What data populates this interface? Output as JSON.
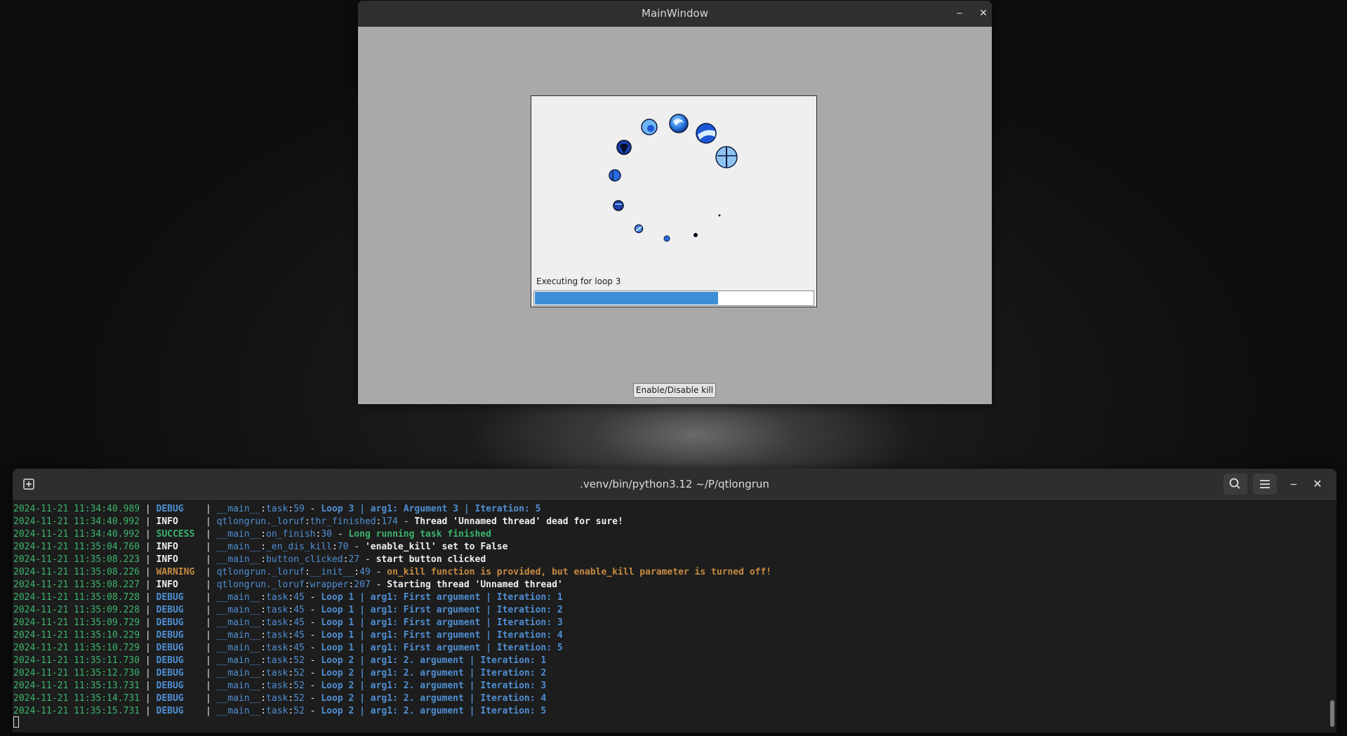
{
  "main_window": {
    "title": "MainWindow",
    "minimize_glyph": "‒",
    "close_glyph": "✕",
    "dialog": {
      "status_text": "Executing for loop 3",
      "progress_percent": 66
    },
    "kill_button_label": "Enable/Disable kill"
  },
  "terminal": {
    "title": ".venv/bin/python3.12 ~/P/qtlongrun",
    "new_tab_icon": "new-tab-icon",
    "search_icon": "search-icon",
    "menu_icon": "hamburger-menu-icon",
    "minimize_glyph": "‒",
    "close_glyph": "✕",
    "log_lines": [
      {
        "ts": "2024-11-21 11:34:40.989",
        "level": "DEBUG",
        "module": "__main__",
        "func": "task",
        "line": "59",
        "message": "Loop 3 | arg1: Argument 3 | Iteration: 5"
      },
      {
        "ts": "2024-11-21 11:34:40.992",
        "level": "INFO",
        "module": "qtlongrun._loruf",
        "func": "thr_finished",
        "line": "174",
        "message": "Thread 'Unnamed thread' dead for sure!"
      },
      {
        "ts": "2024-11-21 11:34:40.992",
        "level": "SUCCESS",
        "module": "__main__",
        "func": "on_finish",
        "line": "30",
        "message": "Long running task finished"
      },
      {
        "ts": "2024-11-21 11:35:04.760",
        "level": "INFO",
        "module": "__main__",
        "func": "_en_dis_kill",
        "line": "70",
        "message": "'enable_kill' set to False"
      },
      {
        "ts": "2024-11-21 11:35:08.223",
        "level": "INFO",
        "module": "__main__",
        "func": "button_clicked",
        "line": "27",
        "message": "start button clicked"
      },
      {
        "ts": "2024-11-21 11:35:08.226",
        "level": "WARNING",
        "module": "qtlongrun._loruf",
        "func": "__init__",
        "line": "49",
        "message": "on_kill function is provided, but enable_kill parameter is turned off!"
      },
      {
        "ts": "2024-11-21 11:35:08.227",
        "level": "INFO",
        "module": "qtlongrun._loruf",
        "func": "wrapper",
        "line": "207",
        "message": "Starting thread 'Unnamed thread'"
      },
      {
        "ts": "2024-11-21 11:35:08.728",
        "level": "DEBUG",
        "module": "__main__",
        "func": "task",
        "line": "45",
        "message": "Loop 1 | arg1: First argument | Iteration: 1"
      },
      {
        "ts": "2024-11-21 11:35:09.228",
        "level": "DEBUG",
        "module": "__main__",
        "func": "task",
        "line": "45",
        "message": "Loop 1 | arg1: First argument | Iteration: 2"
      },
      {
        "ts": "2024-11-21 11:35:09.729",
        "level": "DEBUG",
        "module": "__main__",
        "func": "task",
        "line": "45",
        "message": "Loop 1 | arg1: First argument | Iteration: 3"
      },
      {
        "ts": "2024-11-21 11:35:10.229",
        "level": "DEBUG",
        "module": "__main__",
        "func": "task",
        "line": "45",
        "message": "Loop 1 | arg1: First argument | Iteration: 4"
      },
      {
        "ts": "2024-11-21 11:35:10.729",
        "level": "DEBUG",
        "module": "__main__",
        "func": "task",
        "line": "45",
        "message": "Loop 1 | arg1: First argument | Iteration: 5"
      },
      {
        "ts": "2024-11-21 11:35:11.730",
        "level": "DEBUG",
        "module": "__main__",
        "func": "task",
        "line": "52",
        "message": "Loop 2 | arg1: 2. argument | Iteration: 1"
      },
      {
        "ts": "2024-11-21 11:35:12.730",
        "level": "DEBUG",
        "module": "__main__",
        "func": "task",
        "line": "52",
        "message": "Loop 2 | arg1: 2. argument | Iteration: 2"
      },
      {
        "ts": "2024-11-21 11:35:13.731",
        "level": "DEBUG",
        "module": "__main__",
        "func": "task",
        "line": "52",
        "message": "Loop 2 | arg1: 2. argument | Iteration: 3"
      },
      {
        "ts": "2024-11-21 11:35:14.731",
        "level": "DEBUG",
        "module": "__main__",
        "func": "task",
        "line": "52",
        "message": "Loop 2 | arg1: 2. argument | Iteration: 4"
      },
      {
        "ts": "2024-11-21 11:35:15.731",
        "level": "DEBUG",
        "module": "__main__",
        "func": "task",
        "line": "52",
        "message": "Loop 2 | arg1: 2. argument | Iteration: 5"
      }
    ]
  },
  "colors": {
    "progress_fill": "#3c8fd6",
    "log_timestamp": "#3bb56c",
    "log_debug": "#4f8fd3",
    "log_success": "#3bb56c",
    "log_warning": "#c58a40",
    "log_info": "#f0f0f0"
  }
}
